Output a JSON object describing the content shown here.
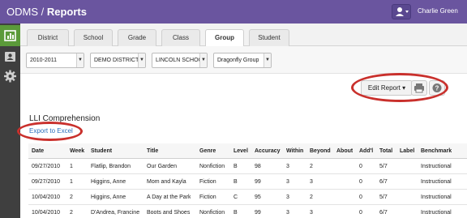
{
  "header": {
    "app_name": "ODMS",
    "separator": "/",
    "page": "Reports",
    "user_icon": "user-icon",
    "user_name": "Charlie Green"
  },
  "sidebar": {
    "items": [
      {
        "icon": "chart-icon",
        "active": true
      },
      {
        "icon": "id-card-icon",
        "active": false
      },
      {
        "icon": "gear-icon",
        "active": false
      }
    ]
  },
  "tabs": [
    "District",
    "School",
    "Grade",
    "Class",
    "Group",
    "Student"
  ],
  "active_tab": "Group",
  "filters": {
    "year": "2010-2011",
    "district": "DEMO DISTRICT",
    "school": "LINCOLN SCHOO",
    "group": "Dragonfly Group"
  },
  "toolbar": {
    "edit_report": "Edit Report",
    "print_icon": "print-icon",
    "help_icon": "help-icon"
  },
  "report": {
    "title": "LLI Comprehension",
    "export_label": "Export to Excel"
  },
  "table": {
    "columns": [
      "Date",
      "Week",
      "Student",
      "Title",
      "Genre",
      "Level",
      "Accuracy",
      "Within",
      "Beyond",
      "About",
      "Add'l",
      "Total",
      "Label",
      "Benchmark"
    ],
    "rows": [
      [
        "09/27/2010",
        "1",
        "Flatlip, Brandon",
        "Our Garden",
        "Nonfiction",
        "B",
        "98",
        "3",
        "2",
        "",
        "0",
        "5/7",
        "",
        "Instructional"
      ],
      [
        "09/27/2010",
        "1",
        "Higgins, Anne",
        "Mom and Kayla",
        "Fiction",
        "B",
        "99",
        "3",
        "3",
        "",
        "0",
        "6/7",
        "",
        "Instructional"
      ],
      [
        "10/04/2010",
        "2",
        "Higgins, Anne",
        "A Day at the Park",
        "Fiction",
        "C",
        "95",
        "3",
        "2",
        "",
        "0",
        "5/7",
        "",
        "Instructional"
      ],
      [
        "10/04/2010",
        "2",
        "D'Andrea, Francine",
        "Boots and Shoes",
        "Nonfiction",
        "B",
        "99",
        "3",
        "3",
        "",
        "0",
        "6/7",
        "",
        "Instructional"
      ]
    ]
  },
  "colors": {
    "header_bg": "#6a559f",
    "sidebar_bg": "#3f3f3f",
    "sidebar_active": "#5b9a3a",
    "highlight": "#c9302c",
    "link": "#2a6ebb"
  }
}
